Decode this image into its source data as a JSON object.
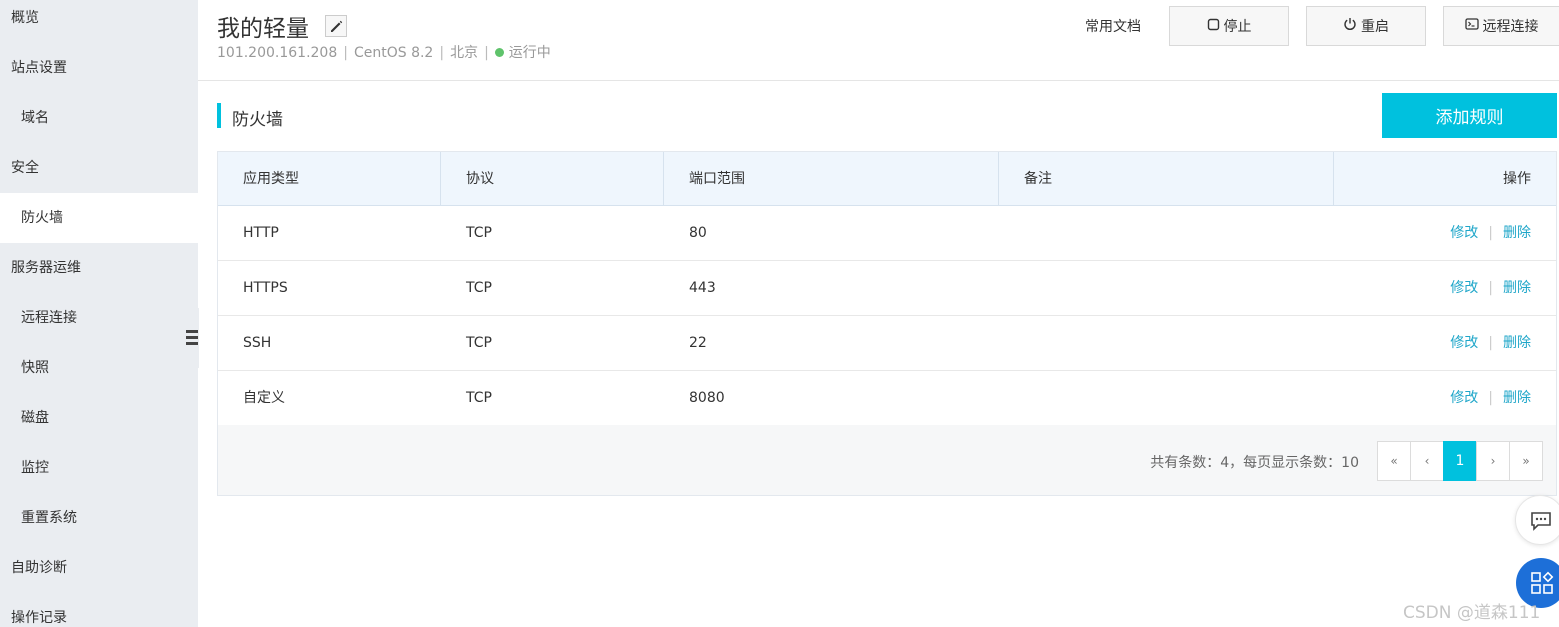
{
  "sidebar": {
    "items": [
      {
        "label": "概览",
        "level": 0,
        "active": false
      },
      {
        "label": "站点设置",
        "level": 0,
        "active": false
      },
      {
        "label": "域名",
        "level": 1,
        "active": false
      },
      {
        "label": "安全",
        "level": 0,
        "active": false
      },
      {
        "label": "防火墙",
        "level": 1,
        "active": true
      },
      {
        "label": "服务器运维",
        "level": 0,
        "active": false
      },
      {
        "label": "远程连接",
        "level": 1,
        "active": false
      },
      {
        "label": "快照",
        "level": 1,
        "active": false
      },
      {
        "label": "磁盘",
        "level": 1,
        "active": false
      },
      {
        "label": "监控",
        "level": 1,
        "active": false
      },
      {
        "label": "重置系统",
        "level": 1,
        "active": false
      },
      {
        "label": "自助诊断",
        "level": 0,
        "active": false
      },
      {
        "label": "操作记录",
        "level": 0,
        "active": false
      }
    ]
  },
  "header": {
    "title": "我的轻量",
    "ip": "101.200.161.208",
    "os": "CentOS 8.2",
    "region": "北京",
    "status": "运行中",
    "sep": "|",
    "doc_link": "常用文档",
    "buttons": {
      "stop": "停止",
      "restart": "重启",
      "remote": "远程连接"
    }
  },
  "section": {
    "title": "防火墙",
    "add_button": "添加规则"
  },
  "table": {
    "columns": [
      "应用类型",
      "协议",
      "端口范围",
      "备注",
      "操作"
    ],
    "rows": [
      {
        "app": "HTTP",
        "protocol": "TCP",
        "port": "80",
        "note": ""
      },
      {
        "app": "HTTPS",
        "protocol": "TCP",
        "port": "443",
        "note": ""
      },
      {
        "app": "SSH",
        "protocol": "TCP",
        "port": "22",
        "note": ""
      },
      {
        "app": "自定义",
        "protocol": "TCP",
        "port": "8080",
        "note": ""
      }
    ],
    "action_edit": "修改",
    "action_sep": "|",
    "action_delete": "删除"
  },
  "pagination": {
    "summary": "共有条数：4，每页显示条数：10",
    "first": "«",
    "prev": "‹",
    "current": "1",
    "next": "›",
    "last": "»"
  },
  "watermark": "CSDN @道森111",
  "colors": {
    "accent": "#00c1de",
    "link": "#1ea6c9",
    "status_running": "#5fc36b",
    "sidebar_bg": "#eaedf1"
  }
}
